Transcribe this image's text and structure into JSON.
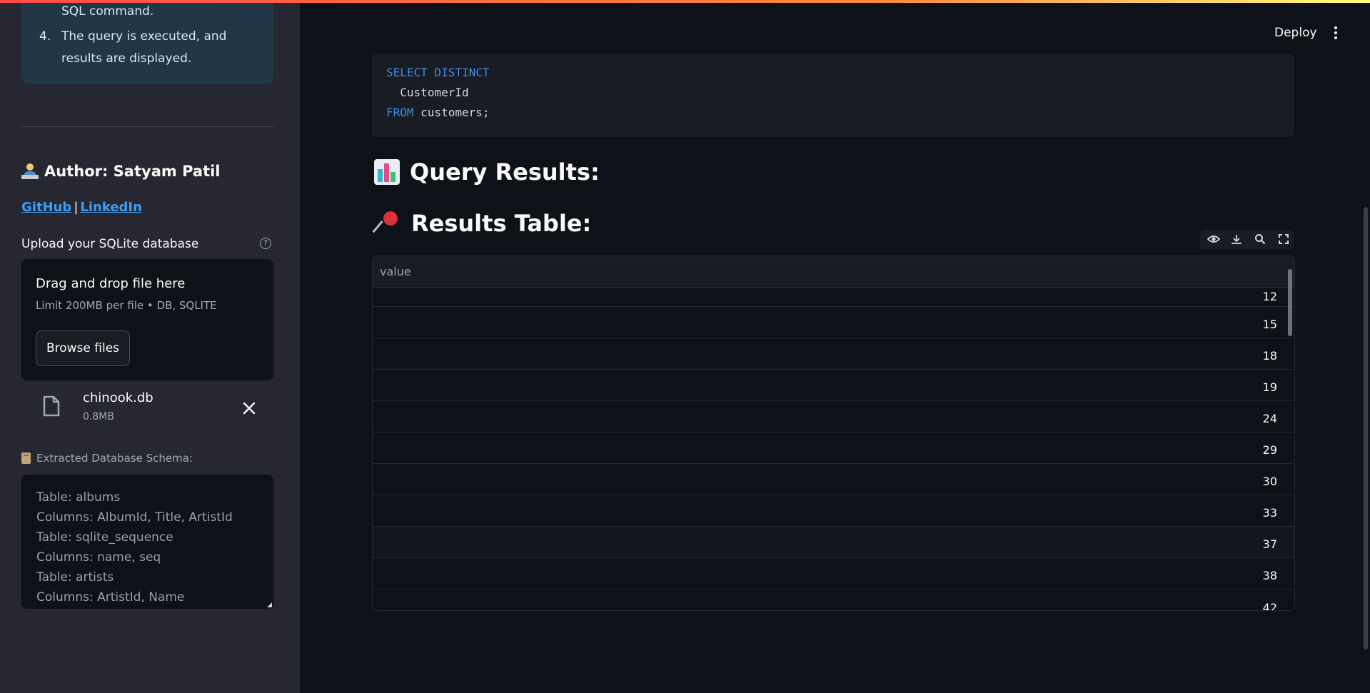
{
  "sidebar": {
    "instructions": {
      "partial_line": "SQL command.",
      "step4_number": "4.",
      "step4_line1": "The query is executed, and",
      "step4_line2": "results are displayed."
    },
    "author": "Author: Satyam Patil",
    "links": {
      "github": "GitHub",
      "separator": "|",
      "linkedin": "LinkedIn"
    },
    "uploader": {
      "label": "Upload your SQLite database",
      "help_icon": "question-circle-icon",
      "drop_title": "Drag and drop file here",
      "drop_sub": "Limit 200MB per file • DB, SQLITE",
      "browse_label": "Browse files",
      "file": {
        "name": "chinook.db",
        "size": "0.8MB"
      }
    },
    "schema": {
      "label": "Extracted Database Schema:",
      "lines": [
        "Table: albums",
        "Columns: AlbumId, Title, ArtistId",
        "Table: sqlite_sequence",
        "Columns: name, seq",
        "Table: artists",
        "Columns: ArtistId, Name"
      ]
    }
  },
  "header": {
    "deploy_label": "Deploy"
  },
  "main": {
    "code": {
      "line1": "SELECT DISTINCT",
      "line2": "  CustomerId",
      "line3_keyword": "FROM",
      "line3_rest": " customers;"
    },
    "query_results_heading": "Query Results:",
    "results_table_heading": "Results Table:",
    "table": {
      "column": "value",
      "rows": [
        "12",
        "15",
        "18",
        "19",
        "24",
        "29",
        "30",
        "33",
        "37",
        "38",
        "42"
      ]
    }
  },
  "colors": {
    "accent": "#ff4b4b",
    "link": "#3d9df3",
    "keyword": "#3b8be6",
    "background": "#0e1117",
    "sidebar": "#262730"
  }
}
